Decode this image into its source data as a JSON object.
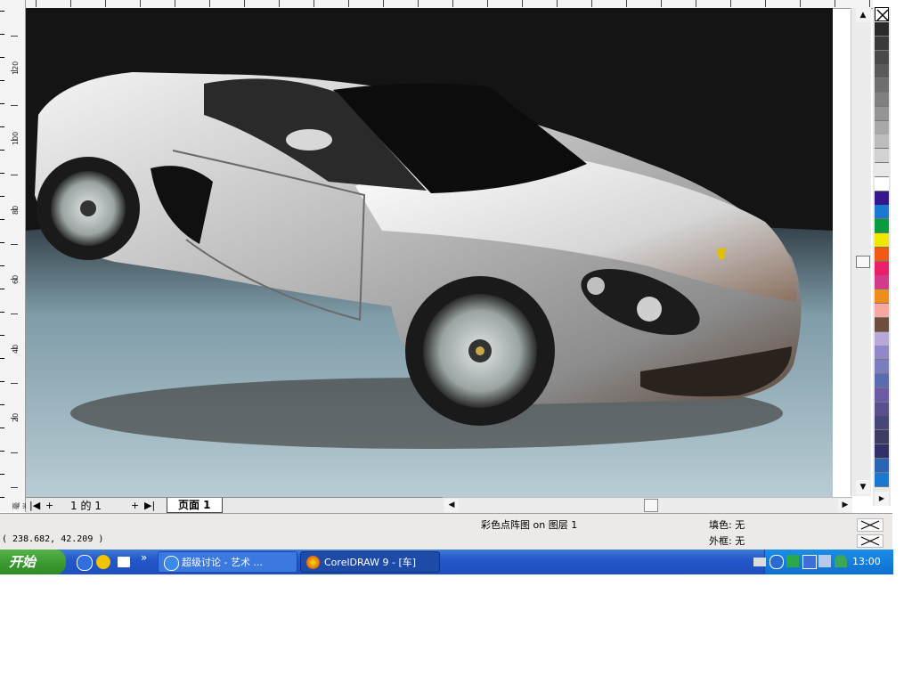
{
  "ruler_left": {
    "labels": [
      "120",
      "100",
      "80",
      "60",
      "40",
      "20",
      "毫米"
    ]
  },
  "page_nav": {
    "count_text": "1 的 1",
    "tab_label": "页面  1"
  },
  "status": {
    "object_info": "彩色点阵图 on 图层 1",
    "fill": "填色: 无",
    "outline": "外框: 无",
    "coordinates": "( 238.682, 42.209 )"
  },
  "taskbar": {
    "start_label": "开始",
    "tasks": [
      {
        "label": "超级讨论 - 艺术 ...",
        "icon": "ie-icon"
      },
      {
        "label": "CorelDRAW 9 - [车]",
        "icon": "coreldraw-icon"
      }
    ],
    "clock": "13:00"
  },
  "palette": {
    "no_color": "none",
    "colors": [
      "#2a2a2a",
      "#3a3a3a",
      "#4a4a4a",
      "#5a5a5a",
      "#6e6e6e",
      "#808080",
      "#949494",
      "#a8a8a8",
      "#bcbcbc",
      "#d2d2d2",
      "#e8e8e8",
      "#ffffff",
      "#35168c",
      "#1a78d0",
      "#0a9b3c",
      "#f0e800",
      "#f05a14",
      "#e8206a",
      "#d23a8c",
      "#f08c1e",
      "#f8a8a0",
      "#6e4e3c",
      "#b8a8d8",
      "#9088c8",
      "#7c7cc0",
      "#5a6cb0",
      "#6c5aa8",
      "#5a4e8c",
      "#464678",
      "#3c3c64",
      "#30306a",
      "#2a64b4",
      "#1a78d0"
    ]
  }
}
